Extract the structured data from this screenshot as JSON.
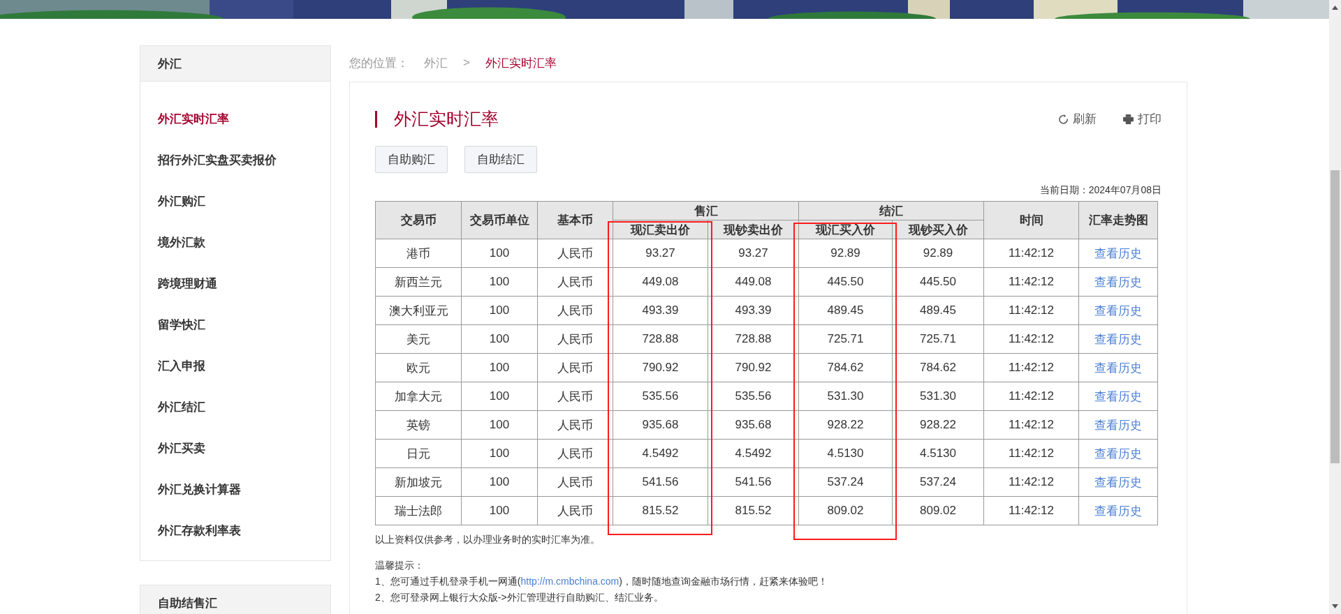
{
  "sidebar": {
    "sections": [
      {
        "title": "外汇",
        "items": [
          {
            "label": "外汇实时汇率",
            "selected": true
          },
          {
            "label": "招行外汇实盘买卖报价",
            "selected": false
          },
          {
            "label": "外汇购汇",
            "selected": false
          },
          {
            "label": "境外汇款",
            "selected": false
          },
          {
            "label": "跨境理财通",
            "selected": false
          },
          {
            "label": "留学快汇",
            "selected": false
          },
          {
            "label": "汇入申报",
            "selected": false
          },
          {
            "label": "外汇结汇",
            "selected": false
          },
          {
            "label": "外汇买卖",
            "selected": false
          },
          {
            "label": "外汇兑换计算器",
            "selected": false
          },
          {
            "label": "外汇存款利率表",
            "selected": false
          }
        ]
      },
      {
        "title": "自助结售汇"
      }
    ]
  },
  "breadcrumb": {
    "prefix": "您的位置：",
    "items": [
      "外汇",
      "外汇实时汇率"
    ],
    "separator": ">"
  },
  "page_title": "外汇实时汇率",
  "actions": [
    {
      "label": "刷新"
    },
    {
      "label": "打印"
    }
  ],
  "buttons": [
    "自助购汇",
    "自助结汇"
  ],
  "date": "当前日期：2024年07月08日",
  "table": {
    "column_groups": [
      {
        "label": "售汇"
      },
      {
        "label": "结汇"
      }
    ],
    "columns": [
      {
        "label": "交易币",
        "highlighted": false
      },
      {
        "label": "交易币单位",
        "highlighted": false
      },
      {
        "label": "基本币",
        "highlighted": false
      },
      {
        "label": "现汇卖出价",
        "highlighted": true
      },
      {
        "label": "现钞卖出价",
        "highlighted": false
      },
      {
        "label": "现汇买入价",
        "highlighted": true
      },
      {
        "label": "现钞买入价",
        "highlighted": false
      },
      {
        "label": "时间",
        "highlighted": false
      },
      {
        "label": "汇率走势图",
        "highlighted": false
      }
    ],
    "rows": [
      [
        "港币",
        "100",
        "人民币",
        "93.27",
        "93.27",
        "92.89",
        "92.89",
        "11:42:12",
        "查看历史"
      ],
      [
        "新西兰元",
        "100",
        "人民币",
        "449.08",
        "449.08",
        "445.50",
        "445.50",
        "11:42:12",
        "查看历史"
      ],
      [
        "澳大利亚元",
        "100",
        "人民币",
        "493.39",
        "493.39",
        "489.45",
        "489.45",
        "11:42:12",
        "查看历史"
      ],
      [
        "美元",
        "100",
        "人民币",
        "728.88",
        "728.88",
        "725.71",
        "725.71",
        "11:42:12",
        "查看历史"
      ],
      [
        "欧元",
        "100",
        "人民币",
        "790.92",
        "790.92",
        "784.62",
        "784.62",
        "11:42:12",
        "查看历史"
      ],
      [
        "加拿大元",
        "100",
        "人民币",
        "535.56",
        "535.56",
        "531.30",
        "531.30",
        "11:42:12",
        "查看历史"
      ],
      [
        "英镑",
        "100",
        "人民币",
        "935.68",
        "935.68",
        "928.22",
        "928.22",
        "11:42:12",
        "查看历史"
      ],
      [
        "日元",
        "100",
        "人民币",
        "4.5492",
        "4.5492",
        "4.5130",
        "4.5130",
        "11:42:12",
        "查看历史"
      ],
      [
        "新加坡元",
        "100",
        "人民币",
        "541.56",
        "541.56",
        "537.24",
        "537.24",
        "11:42:12",
        "查看历史"
      ],
      [
        "瑞士法郎",
        "100",
        "人民币",
        "815.52",
        "815.52",
        "809.02",
        "809.02",
        "11:42:12",
        "查看历史"
      ]
    ]
  },
  "disclaimer": "以上资料仅供参考，以办理业务时的实时汇率为准。",
  "tips": {
    "title": "温馨提示：",
    "lines": [
      {
        "before": "1、您可通过手机登录手机一网通(",
        "link": "http://m.cmbchina.com",
        "after": ")，随时随地查询金融市场行情，赶紧来体验吧！"
      },
      {
        "before": "2、您可登录网上银行大众版->外汇管理进行自助购汇、结汇业务。"
      }
    ]
  }
}
